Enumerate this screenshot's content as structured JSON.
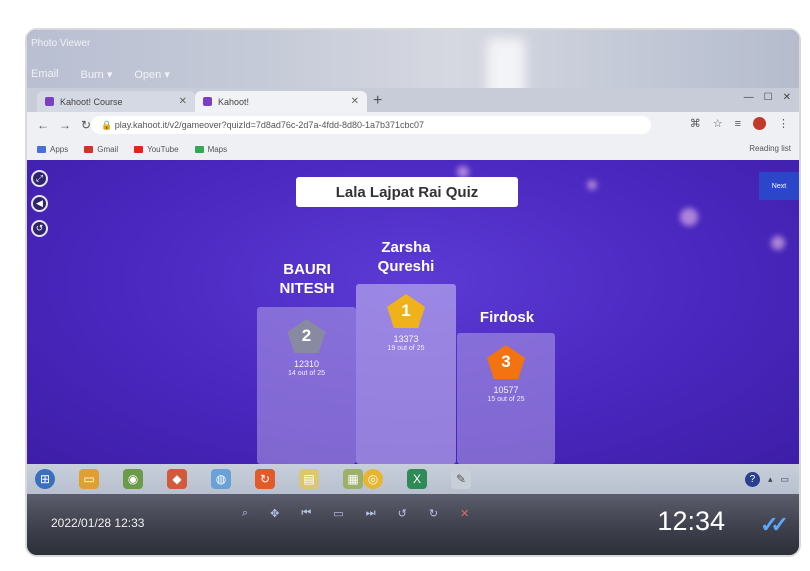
{
  "app_window": {
    "title": "Photo Viewer",
    "menu": [
      "Email",
      "Burn",
      "Open"
    ]
  },
  "browser": {
    "tabs": [
      {
        "label": "Kahoot! Course",
        "active": false
      },
      {
        "label": "Kahoot!",
        "active": true
      }
    ],
    "url": "play.kahoot.it/v2/gameover?quizId=7d8ad76c-2d7a-4fdd-8d80-1a7b371cbc07",
    "bookmarks": [
      "Apps",
      "Gmail",
      "YouTube",
      "Maps"
    ],
    "reading_list": "Reading list",
    "colors": {
      "gmail": "#d93025",
      "youtube": "#e62117",
      "maps": "#34a853"
    }
  },
  "kahoot": {
    "quiz_title": "Lala Lajpat Rai Quiz",
    "next_button": "Next",
    "podium": [
      {
        "rank": "1",
        "name_line1": "Zarsha",
        "name_line2": "Qureshi",
        "score": "13373",
        "correct": "19 out of 25",
        "medal_color": "#f0b21a"
      },
      {
        "rank": "2",
        "name_line1": "BAURI",
        "name_line2": "NITESH",
        "score": "12310",
        "correct": "14 out of 25",
        "medal_color": "#878aa0"
      },
      {
        "rank": "3",
        "name_line1": "Firdosk",
        "name_line2": "",
        "score": "10577",
        "correct": "15 out of 25",
        "medal_color": "#f2730f"
      }
    ],
    "side_icons": [
      "fullscreen-icon",
      "back-icon",
      "refresh-icon"
    ]
  },
  "photo_overlay": {
    "date": "2022/01/28 12:33",
    "time": "12:34",
    "ticks": "✓✓"
  }
}
